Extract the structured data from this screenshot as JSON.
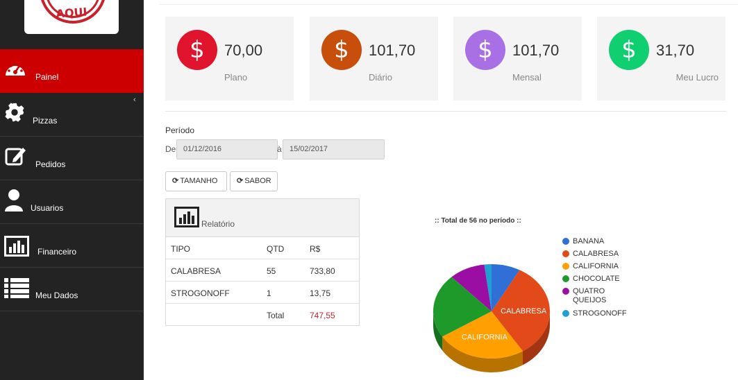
{
  "logo": {
    "text": "AQUI"
  },
  "sidebar": {
    "items": [
      {
        "label": "Painel",
        "icon": "dashboard-icon",
        "active": true
      },
      {
        "label": "Pizzas",
        "icon": "gear-icon",
        "active": false
      },
      {
        "label": "Pedidos",
        "icon": "edit-icon",
        "active": false
      },
      {
        "label": "Usuarios",
        "icon": "user-icon",
        "active": false
      },
      {
        "label": "Financeiro",
        "icon": "bar-chart-icon",
        "active": false
      },
      {
        "label": "Meu Dados",
        "icon": "list-icon",
        "active": false
      }
    ],
    "collapse_glyph": "‹"
  },
  "stats": [
    {
      "value": "70,00",
      "label": "Plano",
      "color": "#e0142d",
      "icon_glyph": "$"
    },
    {
      "value": "101,70",
      "label": "Diário",
      "color": "#c84e0c",
      "icon_glyph": "$"
    },
    {
      "value": "101,70",
      "label": "Mensal",
      "color": "#a970e6",
      "icon_glyph": "$"
    },
    {
      "value": "31,70",
      "label": "Meu Lucro",
      "color": "#0fcf70",
      "icon_glyph": "$"
    }
  ],
  "periodo": {
    "title": "Período",
    "de_label": "De",
    "a_label": "à",
    "start": "01/12/2016",
    "end": "15/02/2017"
  },
  "buttons": {
    "tamanho": "TAMANHO",
    "sabor": "SABOR",
    "refresh_glyph": "⟳"
  },
  "report": {
    "title": "Relatório",
    "columns": [
      "TIPO",
      "QTD",
      "R$"
    ],
    "rows": [
      {
        "tipo": "CALABRESA",
        "qtd": "55",
        "valor": "733,80"
      },
      {
        "tipo": "STROGONOFF",
        "qtd": "1",
        "valor": "13,75"
      }
    ],
    "total_label": "Total",
    "total_value": "747,55"
  },
  "chart_data": {
    "type": "pie",
    "title": ":: Total de 56 no período ::",
    "legend_position": "right",
    "categories": [
      "BANANA",
      "CALABRESA",
      "CALIFORNIA",
      "CHOCOLATE",
      "QUATRO QUEIJOS",
      "STROGONOFF"
    ],
    "values": [
      8,
      33,
      25,
      22,
      10,
      2
    ],
    "colors": [
      "#2f6fd6",
      "#e24a1a",
      "#ff9f00",
      "#1e9a2a",
      "#9a0ea3",
      "#1ea0d2"
    ],
    "slice_labels": [
      "",
      "CALABRESA",
      "CALIFORNIA",
      "",
      "",
      ""
    ]
  }
}
